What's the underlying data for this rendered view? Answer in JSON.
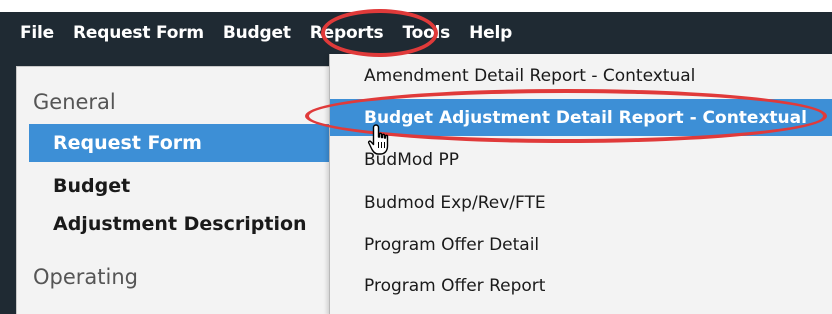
{
  "menubar": {
    "items": [
      "File",
      "Request Form",
      "Budget",
      "Reports",
      "Tools",
      "Help"
    ]
  },
  "left_panel": {
    "general_header": "General",
    "items": [
      "Request Form",
      "Budget",
      "Adjustment Description"
    ],
    "active_item": "Request Form",
    "operating_header": "Operating"
  },
  "reports_menu": {
    "items": [
      "Amendment Detail Report - Contextual",
      "Budget Adjustment Detail Report - Contextual",
      "BudMod PP",
      "Budmod Exp/Rev/FTE",
      "Program Offer Detail",
      "Program Offer Report"
    ],
    "highlighted_item": "Budget Adjustment Detail Report - Contextual"
  },
  "colors": {
    "menubar_bg": "#1f2a33",
    "highlight": "#3d8fd6",
    "annotation": "#e03a3a"
  },
  "icons": {
    "cursor": "hand-pointer-cursor-icon"
  }
}
